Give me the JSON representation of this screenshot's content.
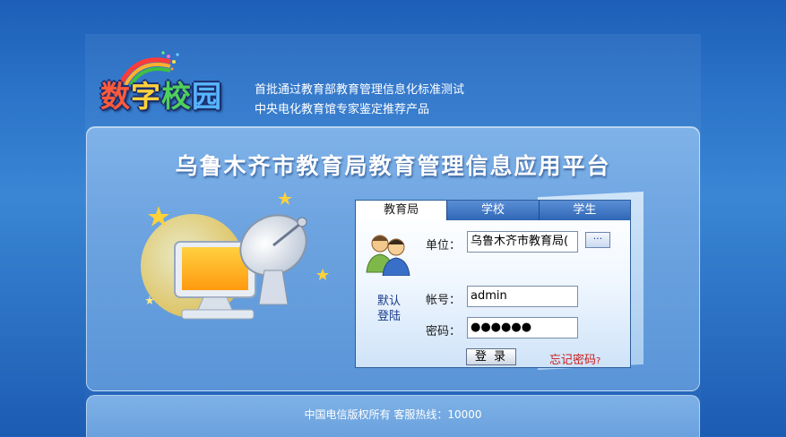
{
  "logo": {
    "text": "数字校园"
  },
  "tagline": {
    "line1": "首批通过教育部教育管理信息化标准测试",
    "line2": "中央电化教育馆专家鉴定推荐产品"
  },
  "panel": {
    "title": "乌鲁木齐市教育局教育管理信息应用平台"
  },
  "login": {
    "tabs": [
      {
        "label": "教育局",
        "active": true
      },
      {
        "label": "学校",
        "active": false
      },
      {
        "label": "学生",
        "active": false
      }
    ],
    "default_login": "默认登陆",
    "unit_label": "单位：",
    "unit_value": "乌鲁木齐市教育局(",
    "browse_label": "···",
    "account_label": "帐号：",
    "account_value": "admin",
    "password_label": "密码：",
    "password_value": "●●●●●●",
    "login_button": "登 录",
    "forgot_text": "忘记密码",
    "forgot_q": "?"
  },
  "footer": {
    "text": "中国电信版权所有  客服热线：10000"
  }
}
